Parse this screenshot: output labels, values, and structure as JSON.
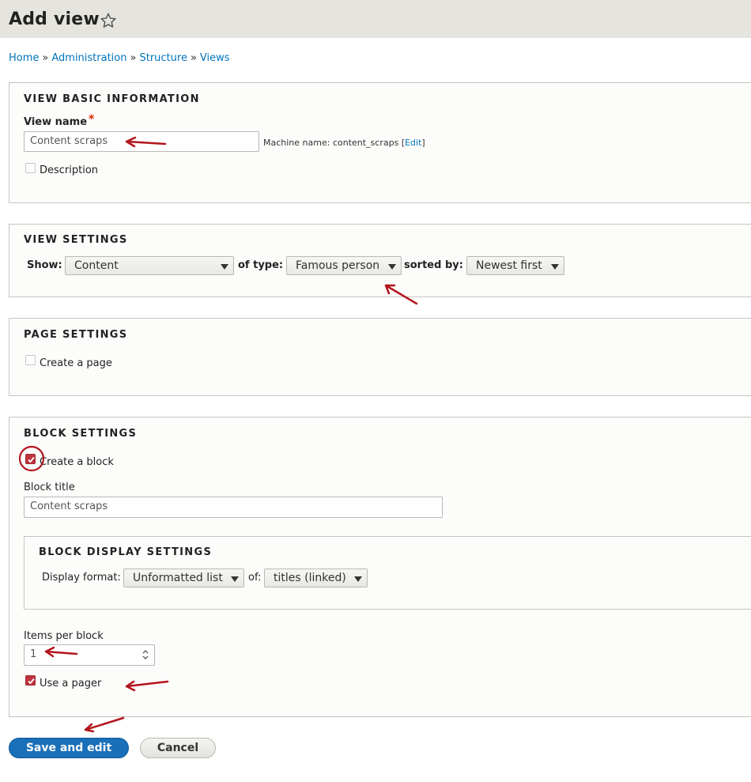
{
  "header": {
    "title": "Add view",
    "star_icon": "star-outline-icon"
  },
  "breadcrumb": [
    "Home",
    "Administration",
    "Structure",
    "Views"
  ],
  "breadcrumb_separator": "»",
  "basic": {
    "legend": "VIEW BASIC INFORMATION",
    "view_name_label": "View name",
    "required_marker": "*",
    "view_name_value": "Content scraps",
    "machine_name_prefix": "Machine name: content_scraps",
    "edit_link": "Edit",
    "description_label": "Description"
  },
  "view_settings": {
    "legend": "VIEW SETTINGS",
    "show_label": "Show:",
    "show_value": "Content",
    "type_label": "of type:",
    "type_value": "Famous person",
    "sorted_label": "sorted by:",
    "sorted_value": "Newest first"
  },
  "page_settings": {
    "legend": "PAGE SETTINGS",
    "create_page_label": "Create a page",
    "create_page_checked": false
  },
  "block_settings": {
    "legend": "BLOCK SETTINGS",
    "create_block_label": "Create a block",
    "create_block_checked": true,
    "block_title_label": "Block title",
    "block_title_value": "Content scraps",
    "display": {
      "legend": "BLOCK DISPLAY SETTINGS",
      "format_label": "Display format:",
      "format_value": "Unformatted list",
      "of_label": "of:",
      "of_value": "titles (linked)"
    },
    "items_label": "Items per block",
    "items_value": "1",
    "pager_label": "Use a pager",
    "pager_checked": true
  },
  "actions": {
    "save": "Save and edit",
    "cancel": "Cancel"
  },
  "colors": {
    "accent": "#0074bd",
    "primary_button": "#1a6fb9",
    "annotation": "#b3151d",
    "header_bg": "#e5e4de"
  }
}
